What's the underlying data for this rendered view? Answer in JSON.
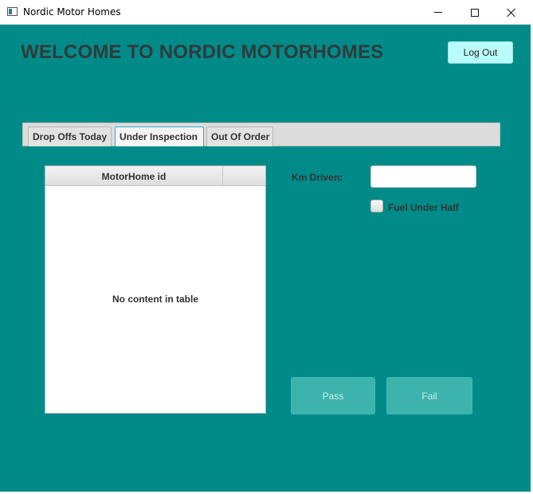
{
  "window": {
    "title": "Nordic Motor Homes",
    "icon": "app-window-icon",
    "controls": [
      "minimize-icon",
      "maximize-icon",
      "close-icon"
    ]
  },
  "header": {
    "title": "WELCOME TO NORDIC MOTORHOMES",
    "logout_label": "Log Out"
  },
  "tabs": [
    {
      "label": "Drop Offs Today",
      "active": false
    },
    {
      "label": "Under Inspection",
      "active": true
    },
    {
      "label": "Out Of Order",
      "active": false
    }
  ],
  "table": {
    "columns": [
      "MotorHome id"
    ],
    "empty_message": "No content in table",
    "rows": []
  },
  "form": {
    "km_label": "Km Driven:",
    "km_value": "",
    "fuel_label": "Fuel Under Half",
    "fuel_checked": false
  },
  "actions": {
    "pass_label": "Pass",
    "fail_label": "Fail",
    "enabled": false
  },
  "colors": {
    "background": "#008b89",
    "logout_button": "#b9fafa",
    "disabled_button": "#3db3ad",
    "title_text": "#2f3b3b"
  }
}
